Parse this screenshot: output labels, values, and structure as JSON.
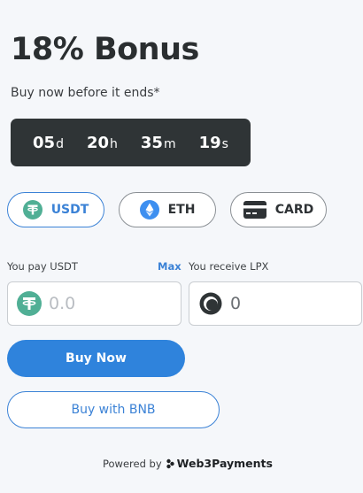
{
  "header": {
    "title": "18% Bonus",
    "subtitle": "Buy now before it ends*"
  },
  "countdown": [
    {
      "value": "05",
      "unit": "d"
    },
    {
      "value": "20",
      "unit": "h"
    },
    {
      "value": "35",
      "unit": "m"
    },
    {
      "value": "19",
      "unit": "s"
    }
  ],
  "tabs": [
    {
      "label": "USDT",
      "icon": "usdt-icon",
      "active": true
    },
    {
      "label": "ETH",
      "icon": "eth-icon",
      "active": false
    },
    {
      "label": "CARD",
      "icon": "card-icon",
      "active": false
    }
  ],
  "pay": {
    "label": "You pay USDT",
    "max_label": "Max",
    "placeholder": "0.0",
    "icon": "usdt-icon"
  },
  "receive": {
    "label": "You receive LPX",
    "value": "0",
    "icon": "lpx-icon"
  },
  "buttons": {
    "buy_now": "Buy Now",
    "buy_bnb": "Buy with BNB"
  },
  "footer": {
    "powered_by": "Powered by",
    "brand": "Web3Payments"
  },
  "colors": {
    "accent": "#3b82d6",
    "primary_button": "#2f83dc",
    "countdown_bg": "#2f3436",
    "usdt_green": "#50af95",
    "eth_blue": "#3d8ff0"
  }
}
